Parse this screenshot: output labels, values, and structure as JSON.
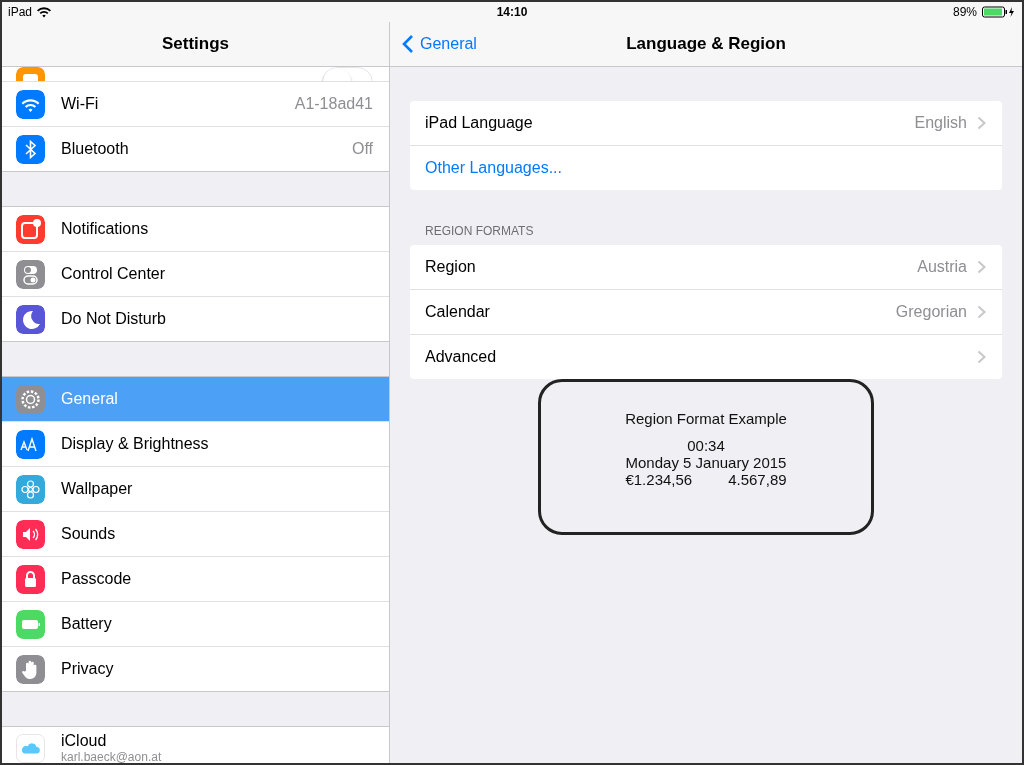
{
  "status_bar": {
    "device": "iPad",
    "time": "14:10",
    "battery": "89%"
  },
  "sidebar": {
    "title": "Settings",
    "groups": [
      {
        "items": [
          {
            "kind": "toggle",
            "on": false,
            "color": "#ff9500"
          },
          {
            "kind": "value",
            "label": "Wi-Fi",
            "value": "A1-18ad41",
            "color": "#007aff",
            "selected": false
          },
          {
            "kind": "value",
            "label": "Bluetooth",
            "value": "Off",
            "color": "#007aff",
            "selected": false
          }
        ]
      },
      {
        "items": [
          {
            "kind": "plain",
            "label": "Notifications",
            "color": "#ff3b30",
            "selected": false
          },
          {
            "kind": "plain",
            "label": "Control Center",
            "color": "#8e8e93",
            "selected": false
          },
          {
            "kind": "plain",
            "label": "Do Not Disturb",
            "color": "#5856d6",
            "selected": false
          }
        ]
      },
      {
        "items": [
          {
            "kind": "plain",
            "label": "General",
            "color": "#8e8e93",
            "selected": true
          },
          {
            "kind": "plain",
            "label": "Display & Brightness",
            "color": "#007aff",
            "selected": false
          },
          {
            "kind": "plain",
            "label": "Wallpaper",
            "color": "#34aadc",
            "selected": false
          },
          {
            "kind": "plain",
            "label": "Sounds",
            "color": "#ff2d55",
            "selected": false
          },
          {
            "kind": "plain",
            "label": "Passcode",
            "color": "#ff2d55",
            "selected": false
          },
          {
            "kind": "plain",
            "label": "Battery",
            "color": "#4cd964",
            "selected": false
          },
          {
            "kind": "plain",
            "label": "Privacy",
            "color": "#8e8e93",
            "selected": false
          }
        ]
      },
      {
        "items": [
          {
            "kind": "account",
            "label": "iCloud",
            "sublabel": "karl.baeck@aon.at",
            "color": "#ffffff",
            "selected": false
          }
        ]
      }
    ]
  },
  "detail": {
    "back": "General",
    "title": "Language & Region",
    "sections": [
      {
        "rows": [
          {
            "kind": "value",
            "label": "iPad Language",
            "value": "English"
          },
          {
            "kind": "link",
            "label": "Other Languages..."
          }
        ]
      },
      {
        "header": "REGION FORMATS",
        "rows": [
          {
            "kind": "value",
            "label": "Region",
            "value": "Austria"
          },
          {
            "kind": "value",
            "label": "Calendar",
            "value": "Gregorian"
          },
          {
            "kind": "value",
            "label": "Advanced"
          }
        ]
      }
    ],
    "example": {
      "title": "Region Format Example",
      "time": "00:34",
      "date": "Monday 5 January 2015",
      "currency": "€1.234,56",
      "number": "4.567,89"
    }
  }
}
